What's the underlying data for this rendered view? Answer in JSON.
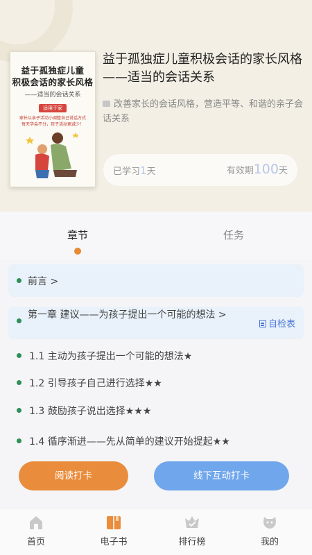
{
  "book": {
    "cover": {
      "title_line1": "益于孤独症儿童",
      "title_line2": "积极会话的家长风格",
      "subtitle": "——适当的会话关系",
      "badge": "适用于家",
      "desc_line1": "家长以亲子活动小调整自己说话方式",
      "desc_line2": "每天学会不分，孩子活动更减少！"
    },
    "title": "益于孤独症儿童积极会话的家长风格——适当的会话关系",
    "description": "改善家长的会话风格，营造平等、和谐的亲子会话关系",
    "studied_label": "已学习",
    "studied_value": "1",
    "studied_unit": "天",
    "validity_label": "有效期",
    "validity_value": "100",
    "validity_unit": "天"
  },
  "tabs": {
    "chapters": "章节",
    "tasks": "任务"
  },
  "preface": {
    "label": "前言 >"
  },
  "chapter1": {
    "label": "第一章 建议——为孩子提出一个可能的想法 >",
    "self_check": "自检表"
  },
  "lessons": [
    {
      "label": "1.1 主动为孩子提出一个可能的想法★"
    },
    {
      "label": "1.2 引导孩子自己进行选择★★"
    },
    {
      "label": "1.3 鼓励孩子说出选择★★★"
    },
    {
      "label": "1.4 循序渐进——先从简单的建议开始提起★★"
    }
  ],
  "buttons": {
    "read": "阅读打卡",
    "offline": "线下互动打卡"
  },
  "nav": {
    "home": "首页",
    "ebook": "电子书",
    "ranking": "排行榜",
    "mine": "我的"
  },
  "colors": {
    "accent_orange": "#e98c3c",
    "accent_blue": "#6fa6ec",
    "link_blue": "#4a78d8",
    "status_green": "#2e8f58"
  }
}
